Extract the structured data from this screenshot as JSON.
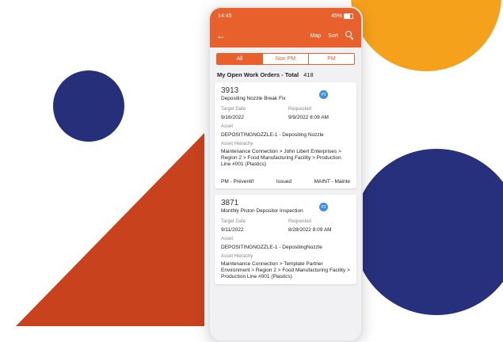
{
  "status_bar": {
    "time": "14:45",
    "battery": "45%"
  },
  "app_bar": {
    "back_icon": "arrow-left-icon",
    "map_label": "Map",
    "sort_label": "Sort",
    "search_icon": "search-icon"
  },
  "filters": [
    "All",
    "Non PM",
    "PM"
  ],
  "summary": {
    "label": "My Open Work Orders - Total",
    "count": "418"
  },
  "cards": [
    {
      "number": "3913",
      "title": "Depositing Nozzle Break Fix",
      "priority": "P2",
      "target_date_label": "Target Date",
      "target_date": "9/16/2022",
      "requested_label": "Requested",
      "requested": "9/9/2022 8:09 AM",
      "asset_label": "Asset",
      "asset": "DEPOSITINGNOZZLE-1 - Depositing Nozzle",
      "hierarchy_label": "Asset Hierachy",
      "hierarchy": "Maintenance Connection > John Libert Enterprises > Region 2 > Food Manufacturing Facility > Production Line #001 (Plastics)",
      "type": "PM - Préventif",
      "status": "Issued",
      "dept": "MAINT - Mainte"
    },
    {
      "number": "3871",
      "title": "Monthly Piston Depositor Inspection",
      "priority": "P2",
      "target_date_label": "Target Date",
      "target_date": "9/11/2022",
      "requested_label": "Requested",
      "requested": "8/28/2022 8:09 AM",
      "asset_label": "Asset",
      "asset": "DEPOSITINGNOZZLE-1 - DepositingNozzle",
      "hierarchy_label": "Asset Hierachy",
      "hierarchy": "Maintenance Connection > Template Partner Environment > Region 2 > Food Manufacturing Facility > Production Line #001 (Plastics)"
    }
  ],
  "colors": {
    "brand_orange": "#e8612d",
    "navy": "#26307a",
    "yellow": "#f5a11b",
    "badge_blue": "#3b8ee2"
  }
}
